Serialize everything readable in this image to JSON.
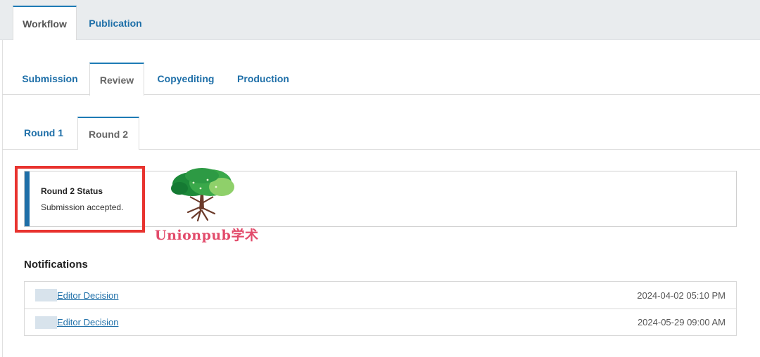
{
  "top_tabs": [
    {
      "label": "Workflow",
      "active": true
    },
    {
      "label": "Publication",
      "active": false
    }
  ],
  "stage_tabs": [
    {
      "label": "Submission",
      "active": false
    },
    {
      "label": "Review",
      "active": true
    },
    {
      "label": "Copyediting",
      "active": false
    },
    {
      "label": "Production",
      "active": false
    }
  ],
  "round_tabs": [
    {
      "label": "Round 1",
      "active": false
    },
    {
      "label": "Round 2",
      "active": true
    }
  ],
  "status": {
    "title": "Round 2 Status",
    "text": "Submission accepted."
  },
  "watermark": {
    "text": "Unionpub学术"
  },
  "notifications": {
    "heading": "Notifications",
    "items": [
      {
        "label": "Editor Decision",
        "date": "2024-04-02 05:10 PM"
      },
      {
        "label": "Editor Decision",
        "date": "2024-05-29 09:00 AM"
      }
    ]
  },
  "colors": {
    "accent": "#1e6fa8",
    "highlight": "#e8332f",
    "watermark": "#e24b6b"
  }
}
